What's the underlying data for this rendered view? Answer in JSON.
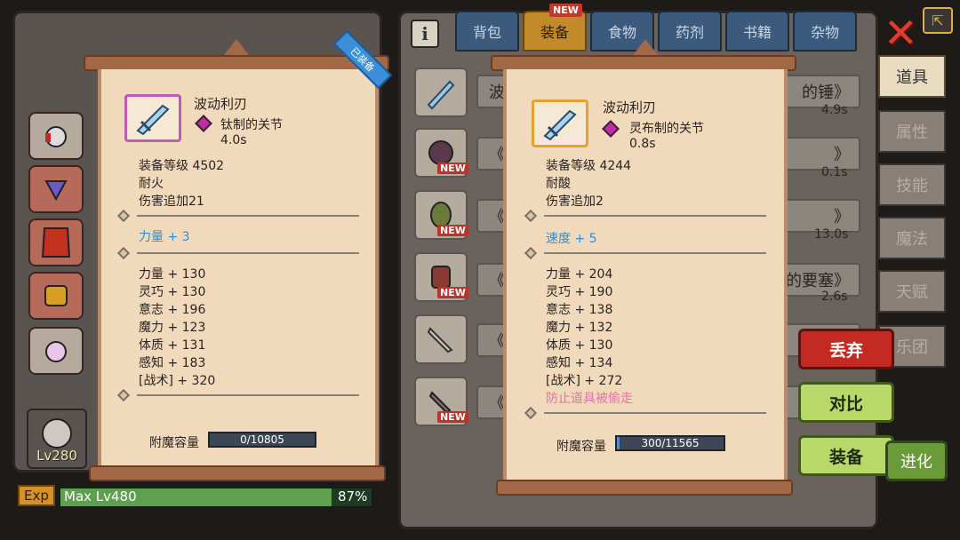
{
  "tabs": [
    "背包",
    "装备",
    "食物",
    "药剂",
    "书籍",
    "杂物"
  ],
  "new_badge": "NEW",
  "info_icon": "i",
  "side_tabs": [
    "道具",
    "属性",
    "技能",
    "魔法",
    "天赋",
    "乐团"
  ],
  "list_rows": [
    {
      "left": "波",
      "right": "的锤》",
      "sub": "4.9s"
    },
    {
      "left": "《",
      "right": "》",
      "sub": "0.1s"
    },
    {
      "left": "《",
      "right": "》",
      "sub": "13.0s"
    },
    {
      "left": "《柒",
      "right": "的要塞》",
      "sub": "2.6s"
    },
    {
      "left": "《",
      "right": "",
      "sub": ""
    },
    {
      "left": "《",
      "right": "",
      "sub": ""
    }
  ],
  "list_new_tag": "NEW",
  "character": {
    "level": "Lv280"
  },
  "exp": {
    "label": "Exp",
    "text": "Max Lv480",
    "percent_text": "87%",
    "fraction": 0.87
  },
  "left_item": {
    "ribbon": "已装备",
    "name": "波动利刃",
    "gem": "钛制的关节",
    "speed": "4.0s",
    "level": "装备等级 4502",
    "prop1": "耐火",
    "prop2": "伤害追加21",
    "bonus": "力量 + 3",
    "stats": [
      "力量 + 130",
      "灵巧 + 130",
      "意志 + 196",
      "魔力 + 123",
      "体质 + 131",
      "感知 + 183",
      "[战术] + 320"
    ],
    "cap_label": "附魔容量",
    "cap_value": "0/10805"
  },
  "right_item": {
    "name": "波动利刃",
    "gem": "灵布制的关节",
    "speed": "0.8s",
    "level": "装备等级 4244",
    "prop1": "耐酸",
    "prop2": "伤害追加2",
    "bonus": "速度 + 5",
    "stats": [
      "力量 + 204",
      "灵巧 + 190",
      "意志 + 138",
      "魔力 + 132",
      "体质 + 130",
      "感知 + 134",
      "[战术] + 272"
    ],
    "special": "防止道具被偷走",
    "cap_label": "附魔容量",
    "cap_value": "300/11565",
    "cap_fraction": 0.026
  },
  "buttons": {
    "discard": "丢弃",
    "compare": "对比",
    "equip": "装备",
    "evolve": "进化"
  },
  "colors": {
    "parchment": "#f1d9bc",
    "blue_stat": "#2a8fd6",
    "pink_text": "#e76fa6",
    "discard": "#c22a22",
    "confirm": "#b9d86a"
  }
}
